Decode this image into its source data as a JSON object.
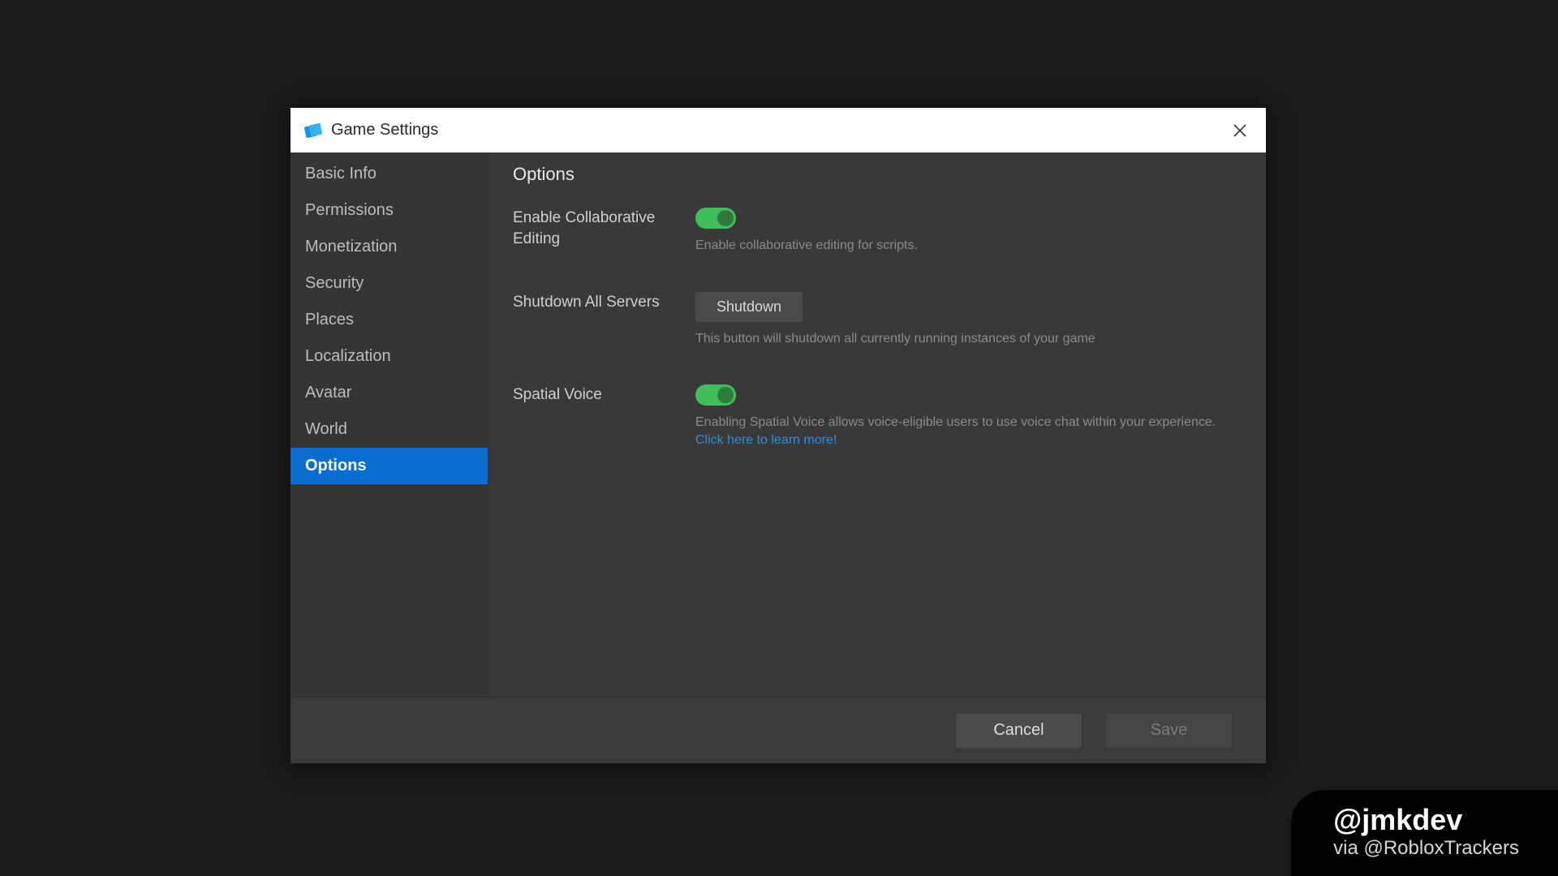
{
  "dialog": {
    "title": "Game Settings"
  },
  "sidebar": {
    "items": [
      {
        "label": "Basic Info",
        "active": false
      },
      {
        "label": "Permissions",
        "active": false
      },
      {
        "label": "Monetization",
        "active": false
      },
      {
        "label": "Security",
        "active": false
      },
      {
        "label": "Places",
        "active": false
      },
      {
        "label": "Localization",
        "active": false
      },
      {
        "label": "Avatar",
        "active": false
      },
      {
        "label": "World",
        "active": false
      },
      {
        "label": "Options",
        "active": true
      }
    ]
  },
  "content": {
    "section_title": "Options",
    "rows": {
      "collab": {
        "label": "Enable Collaborative Editing",
        "toggle_on": true,
        "desc": "Enable collaborative editing for scripts."
      },
      "shutdown": {
        "label": "Shutdown All Servers",
        "button_label": "Shutdown",
        "desc": "This button will shutdown all currently running instances of your game"
      },
      "spatial": {
        "label": "Spatial Voice",
        "toggle_on": true,
        "desc": "Enabling Spatial Voice allows voice-eligible users to use voice chat within your experience. ",
        "link_text": "Click here to learn more!"
      }
    }
  },
  "footer": {
    "cancel_label": "Cancel",
    "save_label": "Save",
    "save_enabled": false
  },
  "watermark": {
    "main": "@jmkdev",
    "sub": "via @RobloxTrackers"
  }
}
